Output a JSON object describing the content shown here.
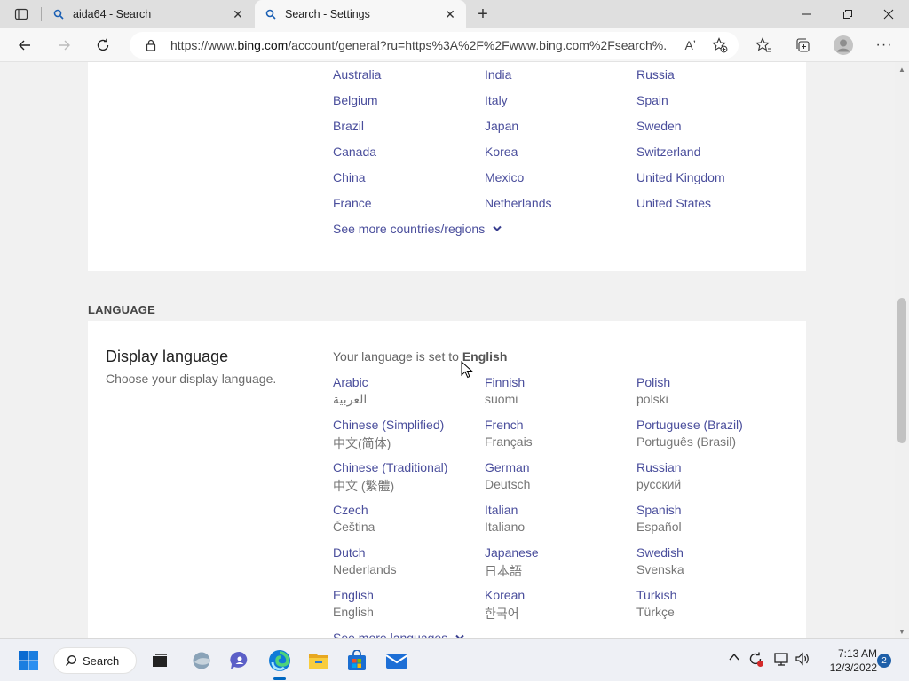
{
  "browser": {
    "tabs": [
      {
        "title": "aida64 - Search",
        "active": false
      },
      {
        "title": "Search - Settings",
        "active": true
      }
    ],
    "address": {
      "url_prefix": "https://www.",
      "url_domain": "bing.com",
      "url_rest": "/account/general?ru=https%3A%2F%2Fwww.bing.com%2Fsearch%..."
    },
    "readaloud_label": "Aʼ"
  },
  "regions": {
    "columns": [
      [
        "Australia",
        "Belgium",
        "Brazil",
        "Canada",
        "China",
        "France"
      ],
      [
        "India",
        "Italy",
        "Japan",
        "Korea",
        "Mexico",
        "Netherlands"
      ],
      [
        "Russia",
        "Spain",
        "Sweden",
        "Switzerland",
        "United Kingdom",
        "United States"
      ]
    ],
    "see_more": "See more countries/regions"
  },
  "language": {
    "section_heading": "LANGUAGE",
    "title": "Display language",
    "subtitle": "Choose your display language.",
    "set_to_prefix": "Your language is set to",
    "set_to_value": "English",
    "columns": [
      [
        {
          "name": "Arabic",
          "native": "العربية"
        },
        {
          "name": "Chinese (Simplified)",
          "native": "中文(简体)"
        },
        {
          "name": "Chinese (Traditional)",
          "native": "中文 (繁體)"
        },
        {
          "name": "Czech",
          "native": "Čeština"
        },
        {
          "name": "Dutch",
          "native": "Nederlands"
        },
        {
          "name": "English",
          "native": "English"
        }
      ],
      [
        {
          "name": "Finnish",
          "native": "suomi"
        },
        {
          "name": "French",
          "native": "Français"
        },
        {
          "name": "German",
          "native": "Deutsch"
        },
        {
          "name": "Italian",
          "native": "Italiano"
        },
        {
          "name": "Japanese",
          "native": "日本語"
        },
        {
          "name": "Korean",
          "native": "한국어"
        }
      ],
      [
        {
          "name": "Polish",
          "native": "polski"
        },
        {
          "name": "Portuguese (Brazil)",
          "native": "Português (Brasil)"
        },
        {
          "name": "Russian",
          "native": "русский"
        },
        {
          "name": "Spanish",
          "native": "Español"
        },
        {
          "name": "Swedish",
          "native": "Svenska"
        },
        {
          "name": "Turkish",
          "native": "Türkçe"
        }
      ]
    ],
    "see_more": "See more languages"
  },
  "taskbar": {
    "search_label": "Search",
    "time": "7:13 AM",
    "date": "12/3/2022",
    "notifications": "2",
    "pinned": [
      "start-icon",
      "search-icon",
      "task-view-icon",
      "widgets-icon",
      "chat-icon",
      "edge-icon",
      "file-explorer-icon",
      "store-icon",
      "mail-icon"
    ]
  },
  "colors": {
    "link": "#4a4e9c",
    "accent": "#0067c0"
  }
}
